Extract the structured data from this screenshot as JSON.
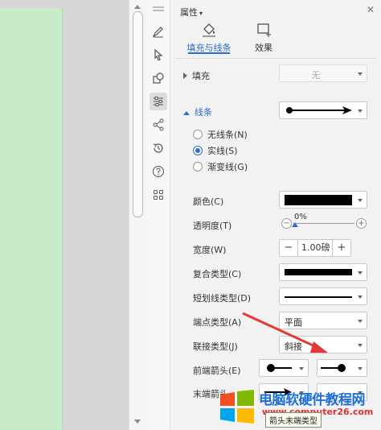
{
  "panel": {
    "title": "属性",
    "tabs": [
      {
        "label": "填充与线条",
        "active": true
      },
      {
        "label": "效果",
        "active": false
      }
    ]
  },
  "fill": {
    "label": "填充",
    "value": "无"
  },
  "line": {
    "label": "线条",
    "options": [
      {
        "label": "无线条(N)",
        "selected": false
      },
      {
        "label": "实线(S)",
        "selected": true
      },
      {
        "label": "渐变线(G)",
        "selected": false
      }
    ]
  },
  "props": {
    "color": {
      "label": "颜色(C)",
      "value": "#000000"
    },
    "transparency": {
      "label": "透明度(T)",
      "value": "0%"
    },
    "width": {
      "label": "宽度(W)",
      "value": "1.00磅"
    },
    "compound": {
      "label": "复合类型(C)"
    },
    "dash": {
      "label": "短划线类型(D)"
    },
    "cap": {
      "label": "端点类型(A)",
      "value": "平面"
    },
    "join": {
      "label": "联接类型(J)",
      "value": "斜接"
    },
    "begin_arrow": {
      "label": "前端箭头(E)"
    },
    "end_arrow": {
      "label": "末端箭头"
    }
  },
  "tooltip": "箭头末端类型",
  "watermark": {
    "title": "电脑软硬件教程网",
    "url": "www.computer26.com"
  },
  "colors": {
    "accent": "#2a6ec8",
    "page": "#c8ebc8",
    "annotation_arrow": "#e53935"
  }
}
